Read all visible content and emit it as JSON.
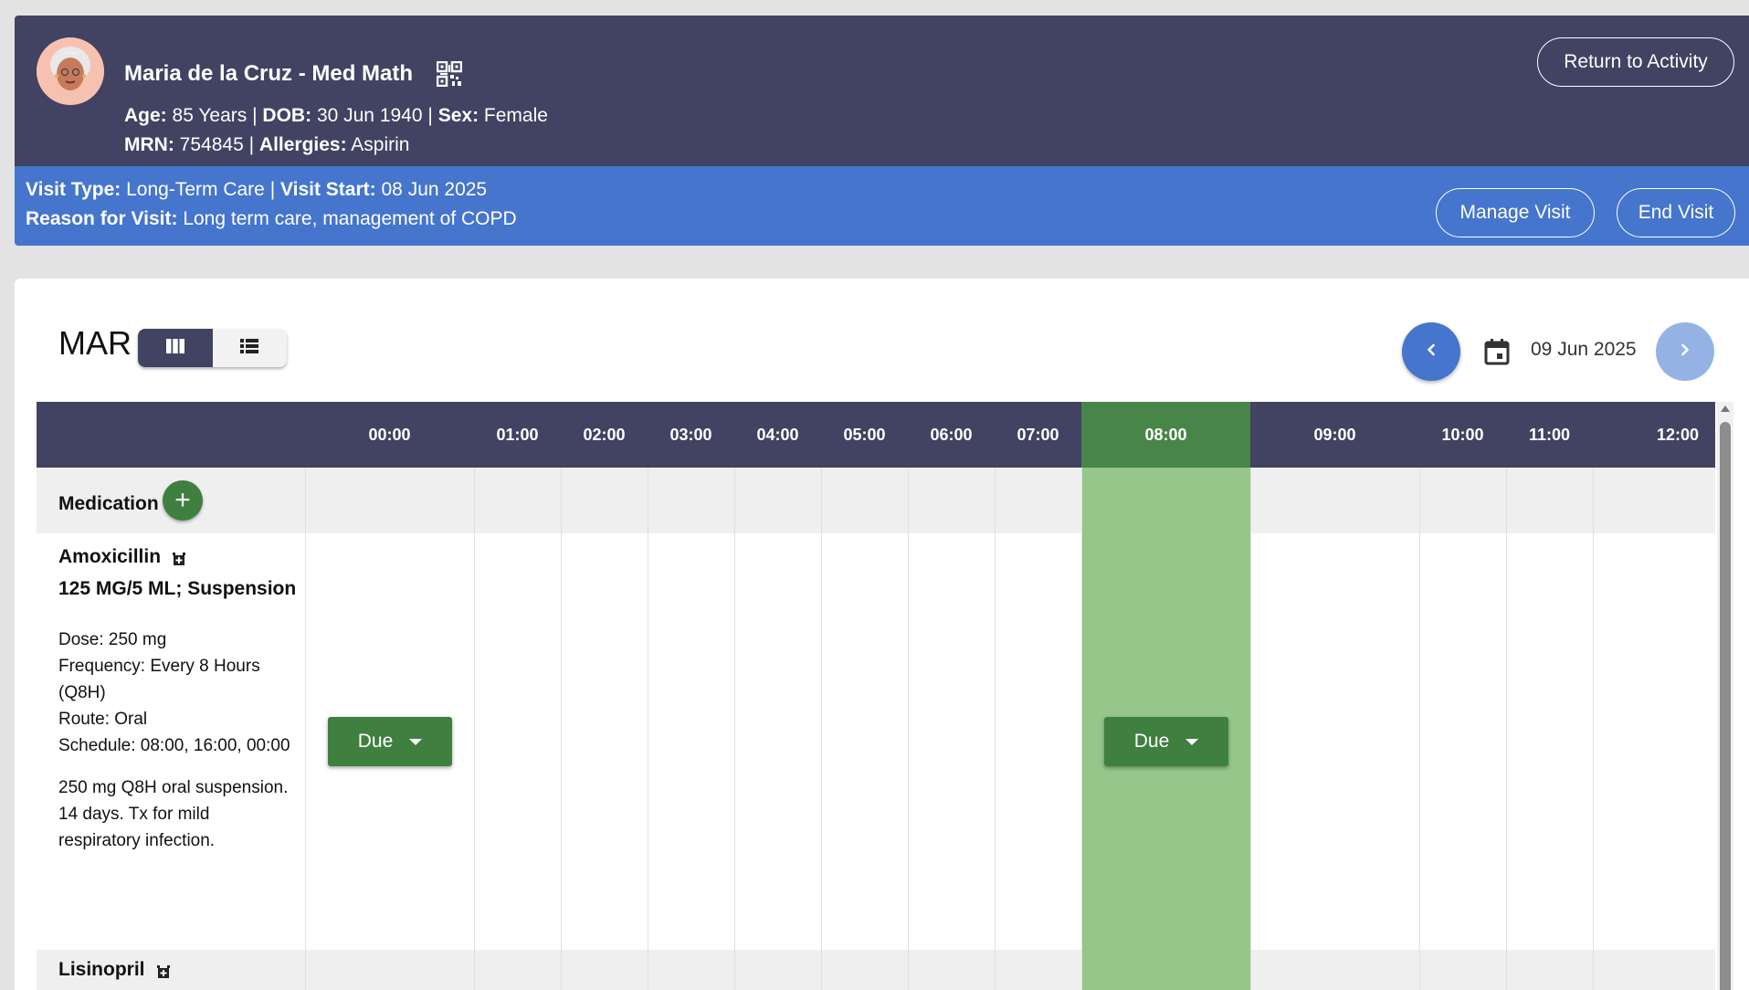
{
  "patient": {
    "name": "Maria de la Cruz - Med Math",
    "age_label": "Age:",
    "age": "85 Years",
    "dob_label": "DOB:",
    "dob": "30 Jun 1940",
    "sex_label": "Sex:",
    "sex": "Female",
    "mrn_label": "MRN:",
    "mrn": "754845",
    "allergies_label": "Allergies:",
    "allergies": "Aspirin",
    "separator": "|",
    "return_label": "Return to Activity",
    "avatar_icon": "patient-avatar",
    "qr_icon": "qr-code-icon"
  },
  "visit": {
    "type_label": "Visit Type:",
    "type": "Long-Term Care",
    "start_label": "Visit Start:",
    "start": "08 Jun 2025",
    "reason_label": "Reason for Visit:",
    "reason": "Long term care, management of COPD",
    "manage_label": "Manage Visit",
    "end_label": "End Visit"
  },
  "mar": {
    "title": "MAR",
    "date": "09 Jun 2025",
    "view_modes": [
      "grid-view-icon",
      "list-view-icon"
    ],
    "active_view": "grid",
    "hours": [
      "00:00",
      "01:00",
      "02:00",
      "03:00",
      "04:00",
      "05:00",
      "06:00",
      "07:00",
      "08:00",
      "09:00",
      "10:00",
      "11:00",
      "12:00"
    ],
    "current_hour": "08:00",
    "medication_header": "Medication",
    "add_icon": "+",
    "medications": [
      {
        "name": "Amoxicillin",
        "strength": "125 MG/5 ML; Suspension",
        "dose": "Dose: 250 mg",
        "frequency": "Frequency: Every 8 Hours (Q8H)",
        "route": "Route: Oral",
        "schedule": "Schedule: 08:00, 16:00, 00:00",
        "note": "250 mg Q8H oral suspension. 14 days. Tx for mild respiratory infection.",
        "due_label": "Due",
        "due_hours": [
          "00:00",
          "08:00"
        ]
      },
      {
        "name": "Lisinopril"
      }
    ]
  },
  "colors": {
    "header_bg": "#424263",
    "visit_bg": "#4575cd",
    "due_green": "#3f7f3f",
    "current_col": "#95c68a",
    "current_header": "#488548"
  }
}
